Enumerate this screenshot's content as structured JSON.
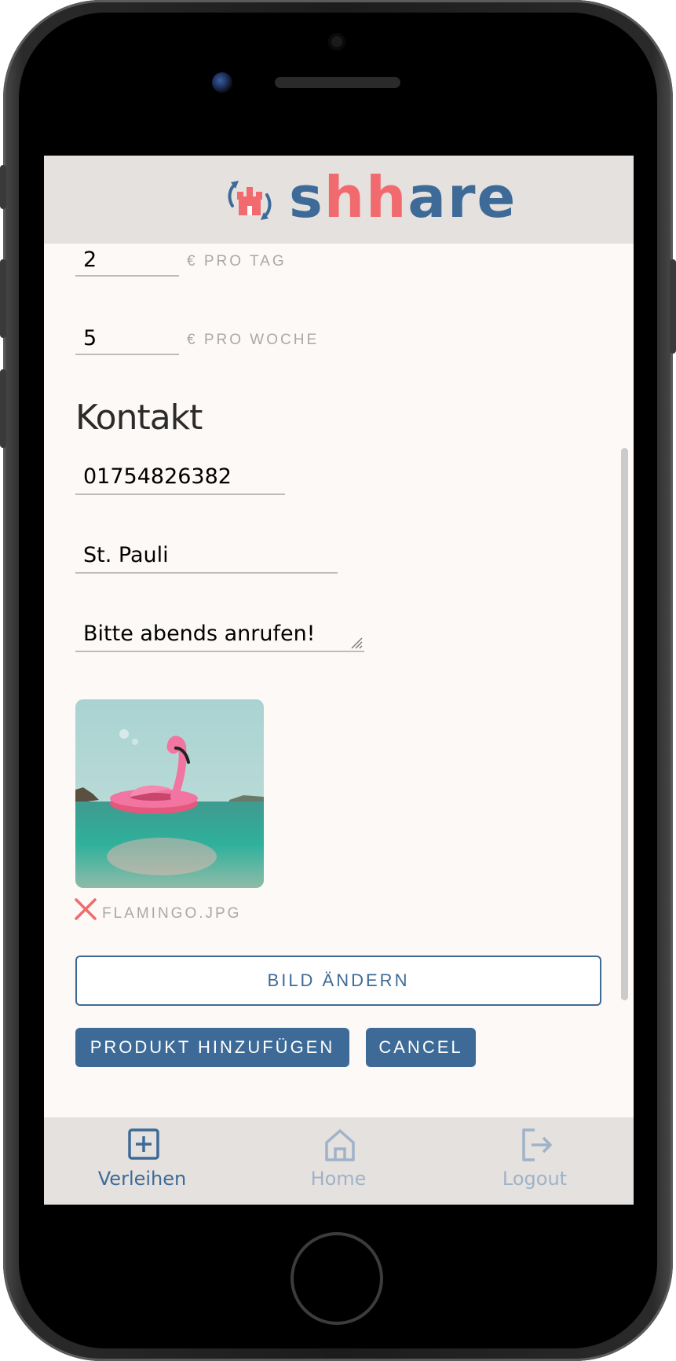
{
  "app": {
    "logo_text_part1": "s",
    "logo_text_highlight": "hh",
    "logo_text_part2": "are",
    "logo_icon": "hamburg-castle-share-icon"
  },
  "pricing": {
    "day_value": "2",
    "day_unit": "€ PRO TAG",
    "week_value": "5",
    "week_unit": "€ PRO WOCHE"
  },
  "contact": {
    "title": "Kontakt",
    "phone_value": "01754826382",
    "location_value": "St. Pauli",
    "note_value": "Bitte abends anrufen!"
  },
  "image": {
    "file_name": "FLAMINGO.JPG",
    "remove_icon": "close-icon"
  },
  "actions": {
    "change_image_label": "BILD ÄNDERN",
    "add_product_label": "PRODUKT HINZUFÜGEN",
    "cancel_label": "CANCEL"
  },
  "nav": {
    "items": [
      {
        "label": "Verleihen",
        "icon": "plus-square-icon",
        "active": true
      },
      {
        "label": "Home",
        "icon": "home-icon",
        "active": false
      },
      {
        "label": "Logout",
        "icon": "logout-icon",
        "active": false
      }
    ]
  },
  "colors": {
    "primary": "#3e6a97",
    "accent": "#f16b6e",
    "background": "#fcf9f6",
    "bar": "#e4e1de",
    "muted": "#a9a9a9",
    "inactive_nav": "#9fb3c8"
  }
}
